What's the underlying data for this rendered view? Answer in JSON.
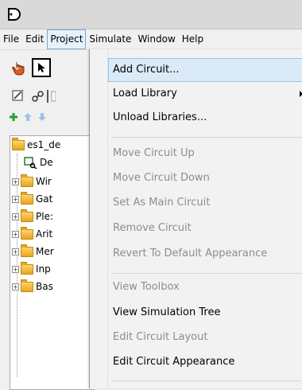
{
  "menubar": {
    "items": [
      "File",
      "Edit",
      "Project",
      "Simulate",
      "Window",
      "Help"
    ],
    "active": "Project"
  },
  "tree": {
    "root_label": "es1_de",
    "circuit_label": "De",
    "folders": [
      "Wir",
      "Gat",
      "Ple:",
      "Arit",
      "Mer",
      "Inp",
      "Bas"
    ]
  },
  "project_menu": {
    "add_circuit": "Add Circuit...",
    "load_library": "Load Library",
    "unload_libraries": "Unload Libraries...",
    "move_circuit_up": "Move Circuit Up",
    "move_circuit_down": "Move Circuit Down",
    "set_as_main_circuit": "Set As Main Circuit",
    "remove_circuit": "Remove Circuit",
    "revert_to_default_appearance": "Revert To Default Appearance",
    "view_toolbox": "View Toolbox",
    "view_simulation_tree": "View Simulation Tree",
    "edit_circuit_layout": "Edit Circuit Layout",
    "edit_circuit_appearance": "Edit Circuit Appearance"
  },
  "colors": {
    "highlight": "#dbeaf8",
    "disabled_text": "#8d8d8d",
    "add_tool_green": "#2f9a2f",
    "move_tool_blue": "#6fa3d8"
  }
}
